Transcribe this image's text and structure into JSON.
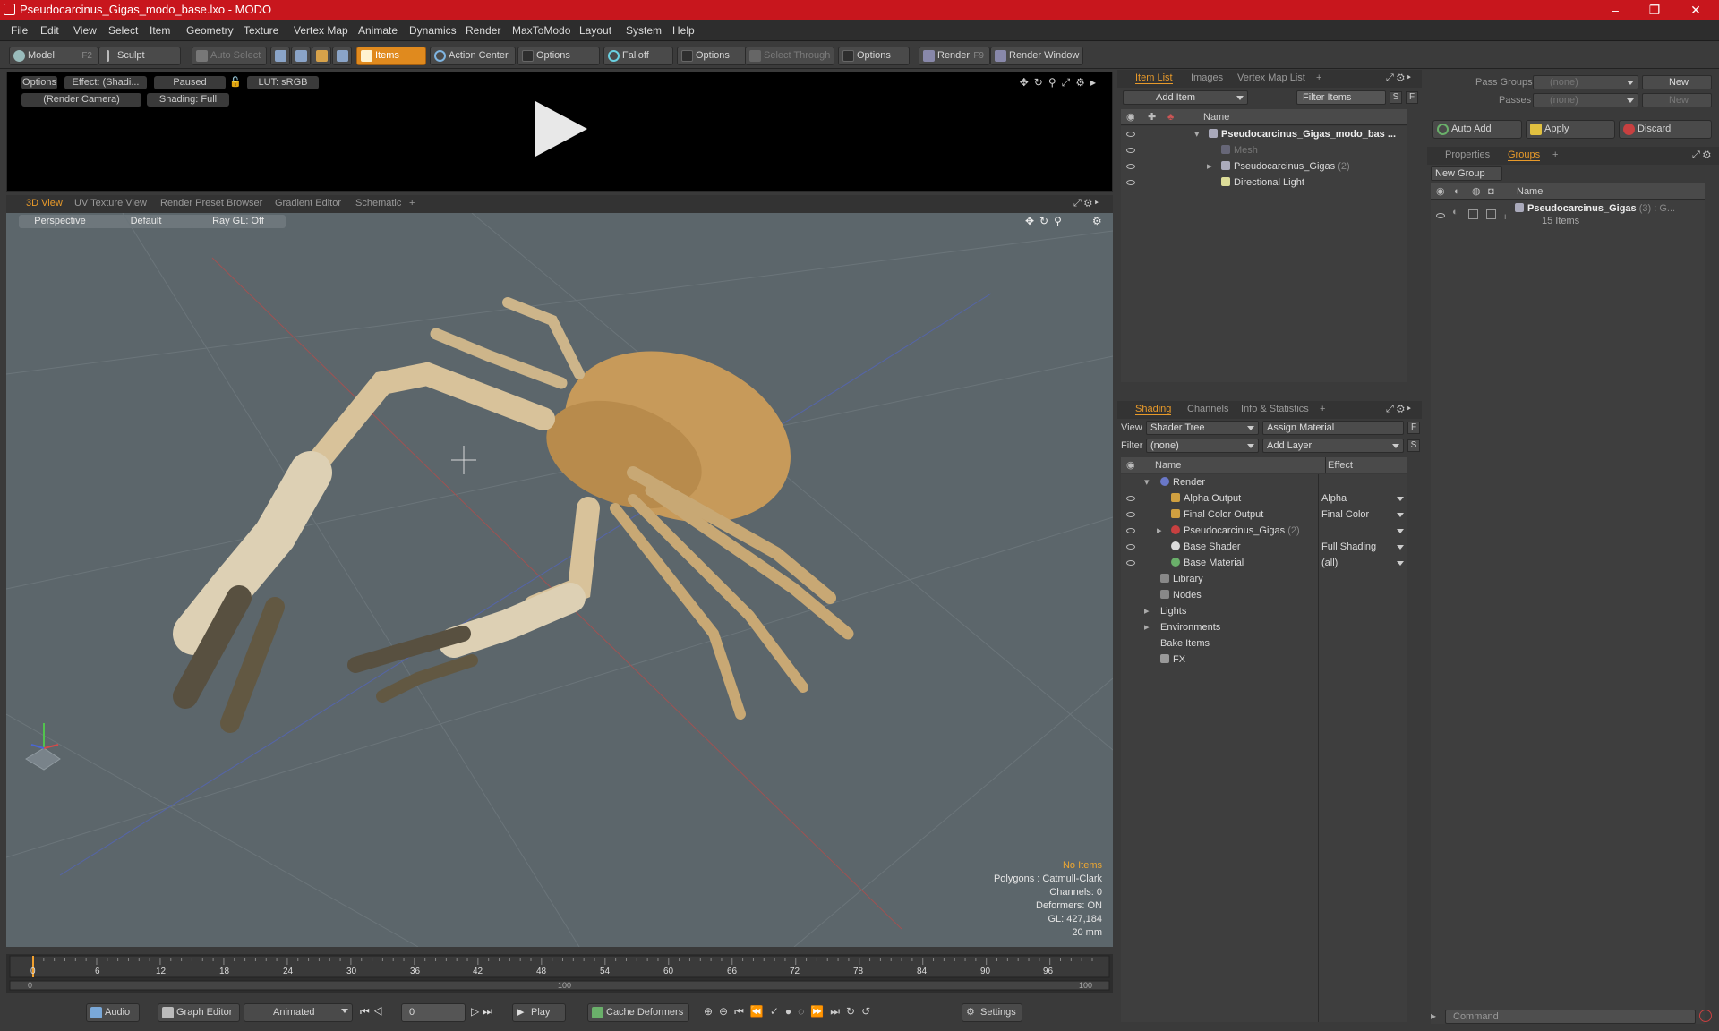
{
  "window": {
    "title": "Pseudocarcinus_Gigas_modo_base.lxo - MODO",
    "minimize": "–",
    "maximize": "❐",
    "close": "✕"
  },
  "menu": [
    "File",
    "Edit",
    "View",
    "Select",
    "Item",
    "Geometry",
    "Texture",
    "Vertex Map",
    "Animate",
    "Dynamics",
    "Render",
    "MaxToModo",
    "Layout",
    "System",
    "Help"
  ],
  "toolbar": {
    "model": "Model",
    "model_key": "F2",
    "sculpt": "Sculpt",
    "auto_select": "Auto Select",
    "items": "Items",
    "action_center": "Action Center",
    "options1": "Options",
    "falloff": "Falloff",
    "options2": "Options",
    "select_through": "Select Through",
    "options3": "Options",
    "render": "Render",
    "render_key": "F9",
    "render_window": "Render Window"
  },
  "preview": {
    "options": "Options",
    "effect": "Effect: (Shadi...",
    "paused": "Paused",
    "lut": "LUT: sRGB",
    "camera": "(Render Camera)",
    "shading": "Shading: Full"
  },
  "view_tabs": [
    "3D View",
    "UV Texture View",
    "Render Preset Browser",
    "Gradient Editor",
    "Schematic",
    "+"
  ],
  "viewport": {
    "perspective": "Perspective",
    "default": "Default",
    "raygl": "Ray GL: Off",
    "hud": {
      "no_items": "No Items",
      "polygons": "Polygons : Catmull-Clark",
      "channels": "Channels: 0",
      "deformers": "Deformers: ON",
      "gl": "GL: 427,184",
      "scale": "20 mm"
    }
  },
  "timeline": {
    "ticks": [
      "0",
      "6",
      "12",
      "18",
      "24",
      "30",
      "36",
      "42",
      "48",
      "54",
      "60",
      "66",
      "72",
      "78",
      "84",
      "90",
      "96"
    ],
    "start": "0",
    "mid": "100",
    "end": "100"
  },
  "bottombar": {
    "audio": "Audio",
    "graph_editor": "Graph Editor",
    "animated": "Animated",
    "frame": "0",
    "play": "Play",
    "cache_deformers": "Cache Deformers",
    "settings": "Settings"
  },
  "itemlist": {
    "tabs": [
      "Item List",
      "Images",
      "Vertex Map List",
      "+"
    ],
    "add_item": "Add Item",
    "filter_items": "Filter Items",
    "col_name": "Name",
    "rows": [
      {
        "label": "Pseudocarcinus_Gigas_modo_bas ...",
        "bold": true
      },
      {
        "label": "Mesh",
        "dim": true
      },
      {
        "label": "Pseudocarcinus_Gigas",
        "suffix": "(2)"
      },
      {
        "label": "Directional Light"
      }
    ]
  },
  "shading": {
    "tabs": [
      "Shading",
      "Channels",
      "Info & Statistics",
      "+"
    ],
    "view_label": "View",
    "view_value": "Shader Tree",
    "assign_material": "Assign Material",
    "filter_label": "Filter",
    "filter_value": "(none)",
    "add_layer": "Add Layer",
    "col_name": "Name",
    "col_effect": "Effect",
    "rows": [
      {
        "label": "Render",
        "effect": ""
      },
      {
        "label": "Alpha Output",
        "effect": "Alpha"
      },
      {
        "label": "Final Color Output",
        "effect": "Final Color"
      },
      {
        "label": "Pseudocarcinus_Gigas",
        "suffix": "(2)",
        "effect": ""
      },
      {
        "label": "Base Shader",
        "effect": "Full Shading"
      },
      {
        "label": "Base Material",
        "effect": "(all)"
      },
      {
        "label": "Library",
        "effect": ""
      },
      {
        "label": "Nodes",
        "effect": ""
      },
      {
        "label": "Lights",
        "effect": ""
      },
      {
        "label": "Environments",
        "effect": ""
      },
      {
        "label": "Bake Items",
        "effect": ""
      },
      {
        "label": "FX",
        "effect": ""
      }
    ]
  },
  "passes": {
    "pass_groups": "Pass Groups",
    "passes": "Passes",
    "none1": "(none)",
    "none2": "(none)",
    "new1": "New",
    "new2": "New",
    "auto_add": "Auto Add",
    "apply": "Apply",
    "discard": "Discard"
  },
  "groups": {
    "tabs": [
      "Properties",
      "Groups",
      "+"
    ],
    "new_group": "New Group",
    "col_name": "Name",
    "item": "Pseudocarcinus_Gigas",
    "item_suffix": "(3) : G...",
    "item_count": "15 Items"
  },
  "command": {
    "placeholder": "Command"
  }
}
